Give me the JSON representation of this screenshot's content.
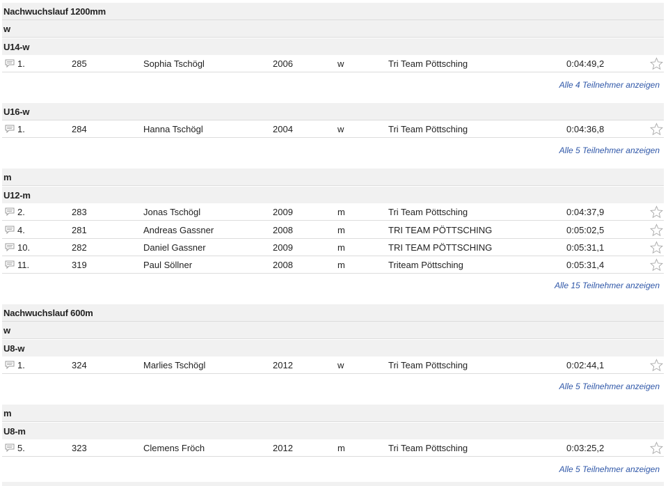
{
  "events": [
    {
      "title": "Nachwuchslauf 1200mm",
      "genders": [
        {
          "label": "w",
          "classes": [
            {
              "label": "U14-w",
              "results": [
                {
                  "rank": "1.",
                  "bib": "285",
                  "name": "Sophia Tschögl",
                  "year": "2006",
                  "sex": "w",
                  "club": "Tri Team Pöttsching",
                  "time": "0:04:49,2"
                }
              ],
              "more": "Alle 4 Teilnehmer anzeigen"
            },
            {
              "label": "U16-w",
              "results": [
                {
                  "rank": "1.",
                  "bib": "284",
                  "name": "Hanna Tschögl",
                  "year": "2004",
                  "sex": "w",
                  "club": "Tri Team Pöttsching",
                  "time": "0:04:36,8"
                }
              ],
              "more": "Alle 5 Teilnehmer anzeigen"
            }
          ]
        },
        {
          "label": "m",
          "classes": [
            {
              "label": "U12-m",
              "results": [
                {
                  "rank": "2.",
                  "bib": "283",
                  "name": "Jonas Tschögl",
                  "year": "2009",
                  "sex": "m",
                  "club": "Tri Team Pöttsching",
                  "time": "0:04:37,9"
                },
                {
                  "rank": "4.",
                  "bib": "281",
                  "name": "Andreas Gassner",
                  "year": "2008",
                  "sex": "m",
                  "club": "TRI TEAM PÖTTSCHING",
                  "time": "0:05:02,5"
                },
                {
                  "rank": "10.",
                  "bib": "282",
                  "name": "Daniel Gassner",
                  "year": "2009",
                  "sex": "m",
                  "club": "TRI TEAM PÖTTSCHING",
                  "time": "0:05:31,1"
                },
                {
                  "rank": "11.",
                  "bib": "319",
                  "name": "Paul Söllner",
                  "year": "2008",
                  "sex": "m",
                  "club": "Triteam Pöttsching",
                  "time": "0:05:31,4"
                }
              ],
              "more": "Alle 15 Teilnehmer anzeigen"
            }
          ]
        }
      ]
    },
    {
      "title": "Nachwuchslauf 600m",
      "genders": [
        {
          "label": "w",
          "classes": [
            {
              "label": "U8-w",
              "results": [
                {
                  "rank": "1.",
                  "bib": "324",
                  "name": "Marlies Tschögl",
                  "year": "2012",
                  "sex": "w",
                  "club": "Tri Team Pöttsching",
                  "time": "0:02:44,1"
                }
              ],
              "more": "Alle 5 Teilnehmer anzeigen"
            }
          ]
        },
        {
          "label": "m",
          "classes": [
            {
              "label": "U8-m",
              "results": [
                {
                  "rank": "5.",
                  "bib": "323",
                  "name": "Clemens Fröch",
                  "year": "2012",
                  "sex": "m",
                  "club": "Tri Team Pöttsching",
                  "time": "0:03:25,2"
                }
              ],
              "more": "Alle 5 Teilnehmer anzeigen"
            }
          ]
        }
      ]
    }
  ],
  "icons": {
    "row_icon": "comment-icon",
    "row_action": "star-icon"
  },
  "colors": {
    "header_bg": "#f1f1f1",
    "link": "#2f57a8",
    "divider": "#dcdcdc"
  }
}
